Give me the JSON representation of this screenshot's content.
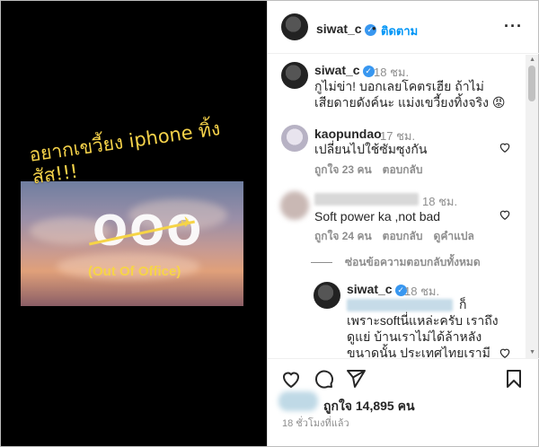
{
  "media": {
    "caption": "อยากเขวี้ยง iphone ทิ้ง สัส!!!",
    "overlay_title": "OOO",
    "overlay_subtitle": "(Out Of Office)",
    "plane_icon": "airplane-icon"
  },
  "header": {
    "username": "siwat_c",
    "follow_label": "ติดตาม",
    "more_icon": "more-options-icon"
  },
  "comments": [
    {
      "username": "siwat_c",
      "time": "18 ชม.",
      "line1": "กูไม่ข่า! บอกเลยโคตรเฮีย ถ้าไม่",
      "line2": "เสียดายดังค์นะ แม่งเขวี้ยงทิ้งจริง 😡"
    },
    {
      "username": "kaopundao",
      "time": "17 ชม.",
      "text": "เปลี่ยนไปใช้ซัมซุงกัน",
      "likes": "ถูกใจ 23 คน",
      "reply": "ตอบกลับ"
    },
    {
      "time": "18 ชม.",
      "text": "Soft power ka ,not bad",
      "likes": "ถูกใจ 24 คน",
      "reply": "ตอบกลับ",
      "translate": "ดูคำแปล"
    }
  ],
  "hide_replies": "ซ่อนข้อความตอบกลับทั้งหมด",
  "reply": {
    "username": "siwat_c",
    "time": "18 ชม.",
    "line1": "ก็",
    "line2": "เพราะsoftนี่แหล่ะครับ เราถึง",
    "line3": "ดูแย่ บ้านเราไม่ได้ล้าหลัง",
    "line4": "ขนาดนั้น ประเทศไทยเรามี"
  },
  "footer": {
    "likes": "ถูกใจ 14,895 คน",
    "ago": "18 ชั่วโมงที่แล้ว"
  }
}
